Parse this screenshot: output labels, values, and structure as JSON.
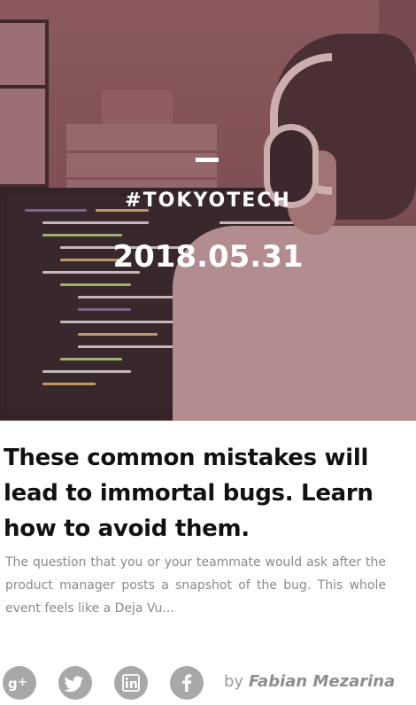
{
  "hero": {
    "tag": "#TOKYOTECH",
    "date": "2018.05.31"
  },
  "article": {
    "title": "These common mistakes will lead to immortal bugs. Learn how to avoid them.",
    "excerpt": "The question that you or your teammate would ask after the product manager posts a snapshot of the bug. This whole event feels like a Deja Vu..."
  },
  "share": {
    "icons": [
      "google-plus-icon",
      "twitter-icon",
      "linkedin-icon",
      "facebook-icon"
    ]
  },
  "byline": {
    "prefix": "by",
    "author": "Fabian Mezarina"
  },
  "colors": {
    "hero_tint": "#7a5053",
    "title": "#111111",
    "excerpt": "#8a8a8a",
    "icon_bg": "#a8a8a8"
  }
}
